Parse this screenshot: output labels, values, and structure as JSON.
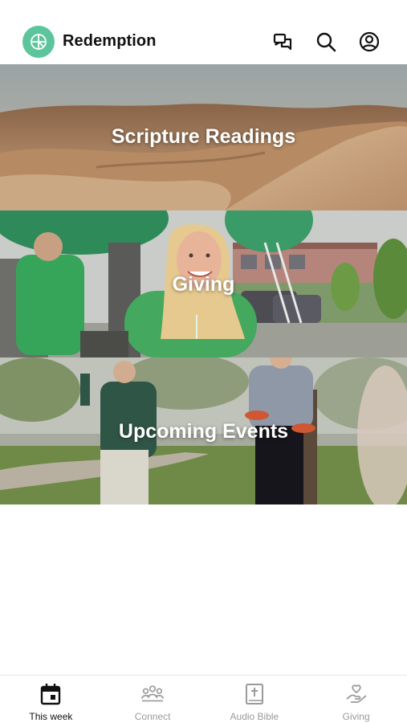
{
  "header": {
    "brand": "Redemption",
    "icons": [
      "messages-icon",
      "search-icon",
      "profile-icon"
    ]
  },
  "tiles": [
    {
      "label": "Scripture Readings"
    },
    {
      "label": "Giving"
    },
    {
      "label": "Upcoming Events"
    }
  ],
  "tabbar": {
    "tabs": [
      {
        "label": "This week",
        "icon": "calendar-icon",
        "active": true
      },
      {
        "label": "Connect",
        "icon": "people-icon",
        "active": false
      },
      {
        "label": "Audio Bible",
        "icon": "bible-icon",
        "active": false
      },
      {
        "label": "Giving",
        "icon": "giving-hand-icon",
        "active": false
      }
    ]
  },
  "colors": {
    "logo": "#5cc59c",
    "active_tab": "#111111",
    "inactive_tab": "#9a9a9a"
  }
}
